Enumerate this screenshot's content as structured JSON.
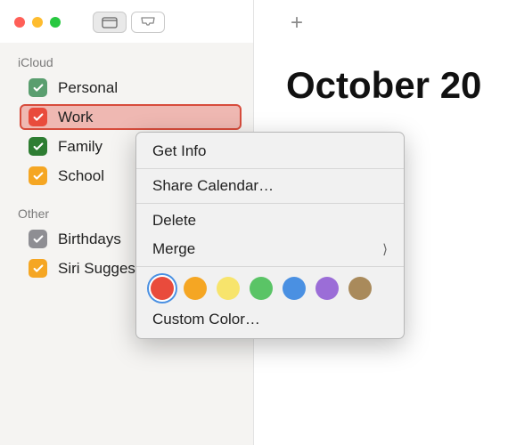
{
  "traffic": {
    "close": "#ff5f57",
    "min": "#febc2e",
    "max": "#28c840"
  },
  "sidebar": {
    "sections": [
      {
        "title": "iCloud",
        "items": [
          {
            "label": "Personal",
            "color": "#5a9e6f",
            "selected": false
          },
          {
            "label": "Work",
            "color": "#e94b3c",
            "selected": true
          },
          {
            "label": "Family",
            "color": "#2e7d32",
            "selected": false
          },
          {
            "label": "School",
            "color": "#f5a623",
            "selected": false
          }
        ]
      },
      {
        "title": "Other",
        "items": [
          {
            "label": "Birthdays",
            "color": "#8e8e93",
            "selected": false
          },
          {
            "label": "Siri Suggestions",
            "color": "#f5a623",
            "selected": false
          }
        ]
      }
    ]
  },
  "main": {
    "month": "October 20"
  },
  "context_menu": {
    "get_info": "Get Info",
    "share": "Share Calendar…",
    "delete": "Delete",
    "merge": "Merge",
    "custom_color": "Custom Color…",
    "colors": [
      "#e94b3c",
      "#f5a623",
      "#f7e46c",
      "#5ac466",
      "#4a90e2",
      "#9b6dd7",
      "#a98a5b"
    ]
  }
}
